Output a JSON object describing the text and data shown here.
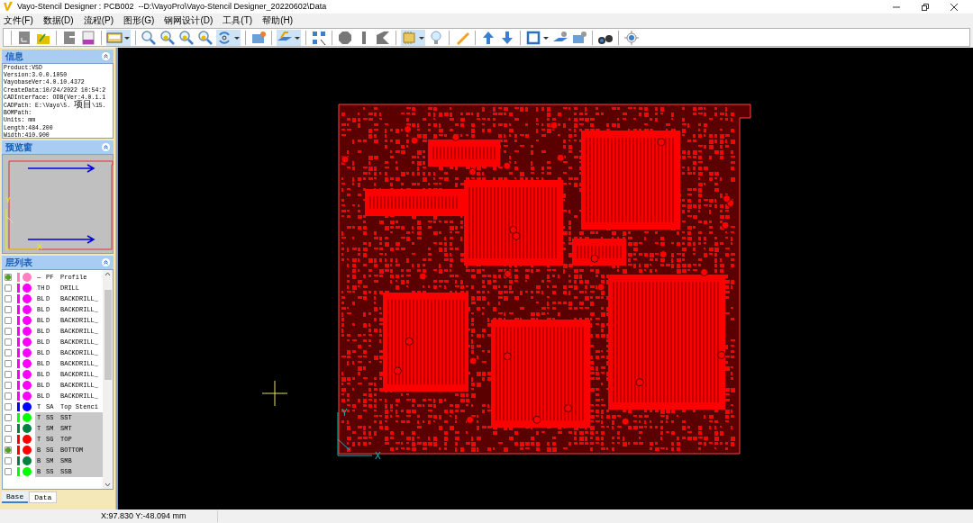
{
  "window": {
    "title": "Vayo-Stencil Designer : PCB002  --D:\\VayoPro\\Vayo-Stencil Designer_20220602\\Data"
  },
  "menu": [
    "文件(F)",
    "数据(D)",
    "流程(P)",
    "图形(G)",
    "钢网设计(D)",
    "工具(T)",
    "帮助(H)"
  ],
  "info_panel": {
    "title": "信息",
    "lines": [
      "Product:VSD",
      "Version:3.0.0.1050",
      "VayobaseVer:4.0.10.4372",
      "CreateData:10/24/2022 10:54:2",
      "CADInterface: ODB(Ver:4.0.1.1",
      "CADPath: E:\\Vayo\\5. 项目\\15.",
      "BOMPath:",
      "Units: mm",
      "Length:484.200",
      "Width:410.900"
    ]
  },
  "preview_panel": {
    "title": "预览窗",
    "axis_x": "X",
    "axis_y": "Y"
  },
  "layer_panel": {
    "title": "层列表",
    "layers": [
      {
        "checked": true,
        "color": "#ff80c0",
        "side": "—",
        "type": "PF",
        "name": "Profile",
        "highlighted": false
      },
      {
        "checked": false,
        "color": "#ff00ff",
        "side": "TH",
        "type": "D",
        "name": "DRILL",
        "highlighted": false
      },
      {
        "checked": false,
        "color": "#ff00ff",
        "side": "BL",
        "type": "D",
        "name": "BACKDRILL_",
        "highlighted": false
      },
      {
        "checked": false,
        "color": "#ff00ff",
        "side": "BL",
        "type": "D",
        "name": "BACKDRILL_",
        "highlighted": false
      },
      {
        "checked": false,
        "color": "#ff00ff",
        "side": "BL",
        "type": "D",
        "name": "BACKDRILL_",
        "highlighted": false
      },
      {
        "checked": false,
        "color": "#ff00ff",
        "side": "BL",
        "type": "D",
        "name": "BACKDRILL_",
        "highlighted": false
      },
      {
        "checked": false,
        "color": "#ff00ff",
        "side": "BL",
        "type": "D",
        "name": "BACKDRILL_",
        "highlighted": false
      },
      {
        "checked": false,
        "color": "#ff00ff",
        "side": "BL",
        "type": "D",
        "name": "BACKDRILL_",
        "highlighted": false
      },
      {
        "checked": false,
        "color": "#ff00ff",
        "side": "BL",
        "type": "D",
        "name": "BACKDRILL_",
        "highlighted": false
      },
      {
        "checked": false,
        "color": "#ff00ff",
        "side": "BL",
        "type": "D",
        "name": "BACKDRILL_",
        "highlighted": false
      },
      {
        "checked": false,
        "color": "#ff00ff",
        "side": "BL",
        "type": "D",
        "name": "BACKDRILL_",
        "highlighted": false
      },
      {
        "checked": false,
        "color": "#ff00ff",
        "side": "BL",
        "type": "D",
        "name": "BACKDRILL_",
        "highlighted": false
      },
      {
        "checked": false,
        "color": "#0000ff",
        "side": "T",
        "type": "SA",
        "name": "Top Stenci",
        "highlighted": false
      },
      {
        "checked": false,
        "color": "#00ff00",
        "side": "T",
        "type": "SS",
        "name": "SST",
        "highlighted": true
      },
      {
        "checked": false,
        "color": "#008040",
        "side": "T",
        "type": "SM",
        "name": "SMT",
        "highlighted": true
      },
      {
        "checked": false,
        "color": "#ff0000",
        "side": "T",
        "type": "SG",
        "name": "TOP",
        "highlighted": true
      },
      {
        "checked": true,
        "color": "#ff0000",
        "side": "B",
        "type": "SG",
        "name": "BOTTOM",
        "highlighted": true
      },
      {
        "checked": false,
        "color": "#008040",
        "side": "B",
        "type": "SM",
        "name": "SMB",
        "highlighted": true
      },
      {
        "checked": false,
        "color": "#00ff00",
        "side": "B",
        "type": "SS",
        "name": "SSB",
        "highlighted": true
      }
    ]
  },
  "bottom_tabs": [
    {
      "label": "Base",
      "selected": true
    },
    {
      "label": "Data",
      "selected": false
    }
  ],
  "canvas": {
    "axis_x": "X",
    "axis_y": "Y"
  },
  "status_bar": {
    "coordinates": "X:97.830 Y:-48.094 mm"
  }
}
